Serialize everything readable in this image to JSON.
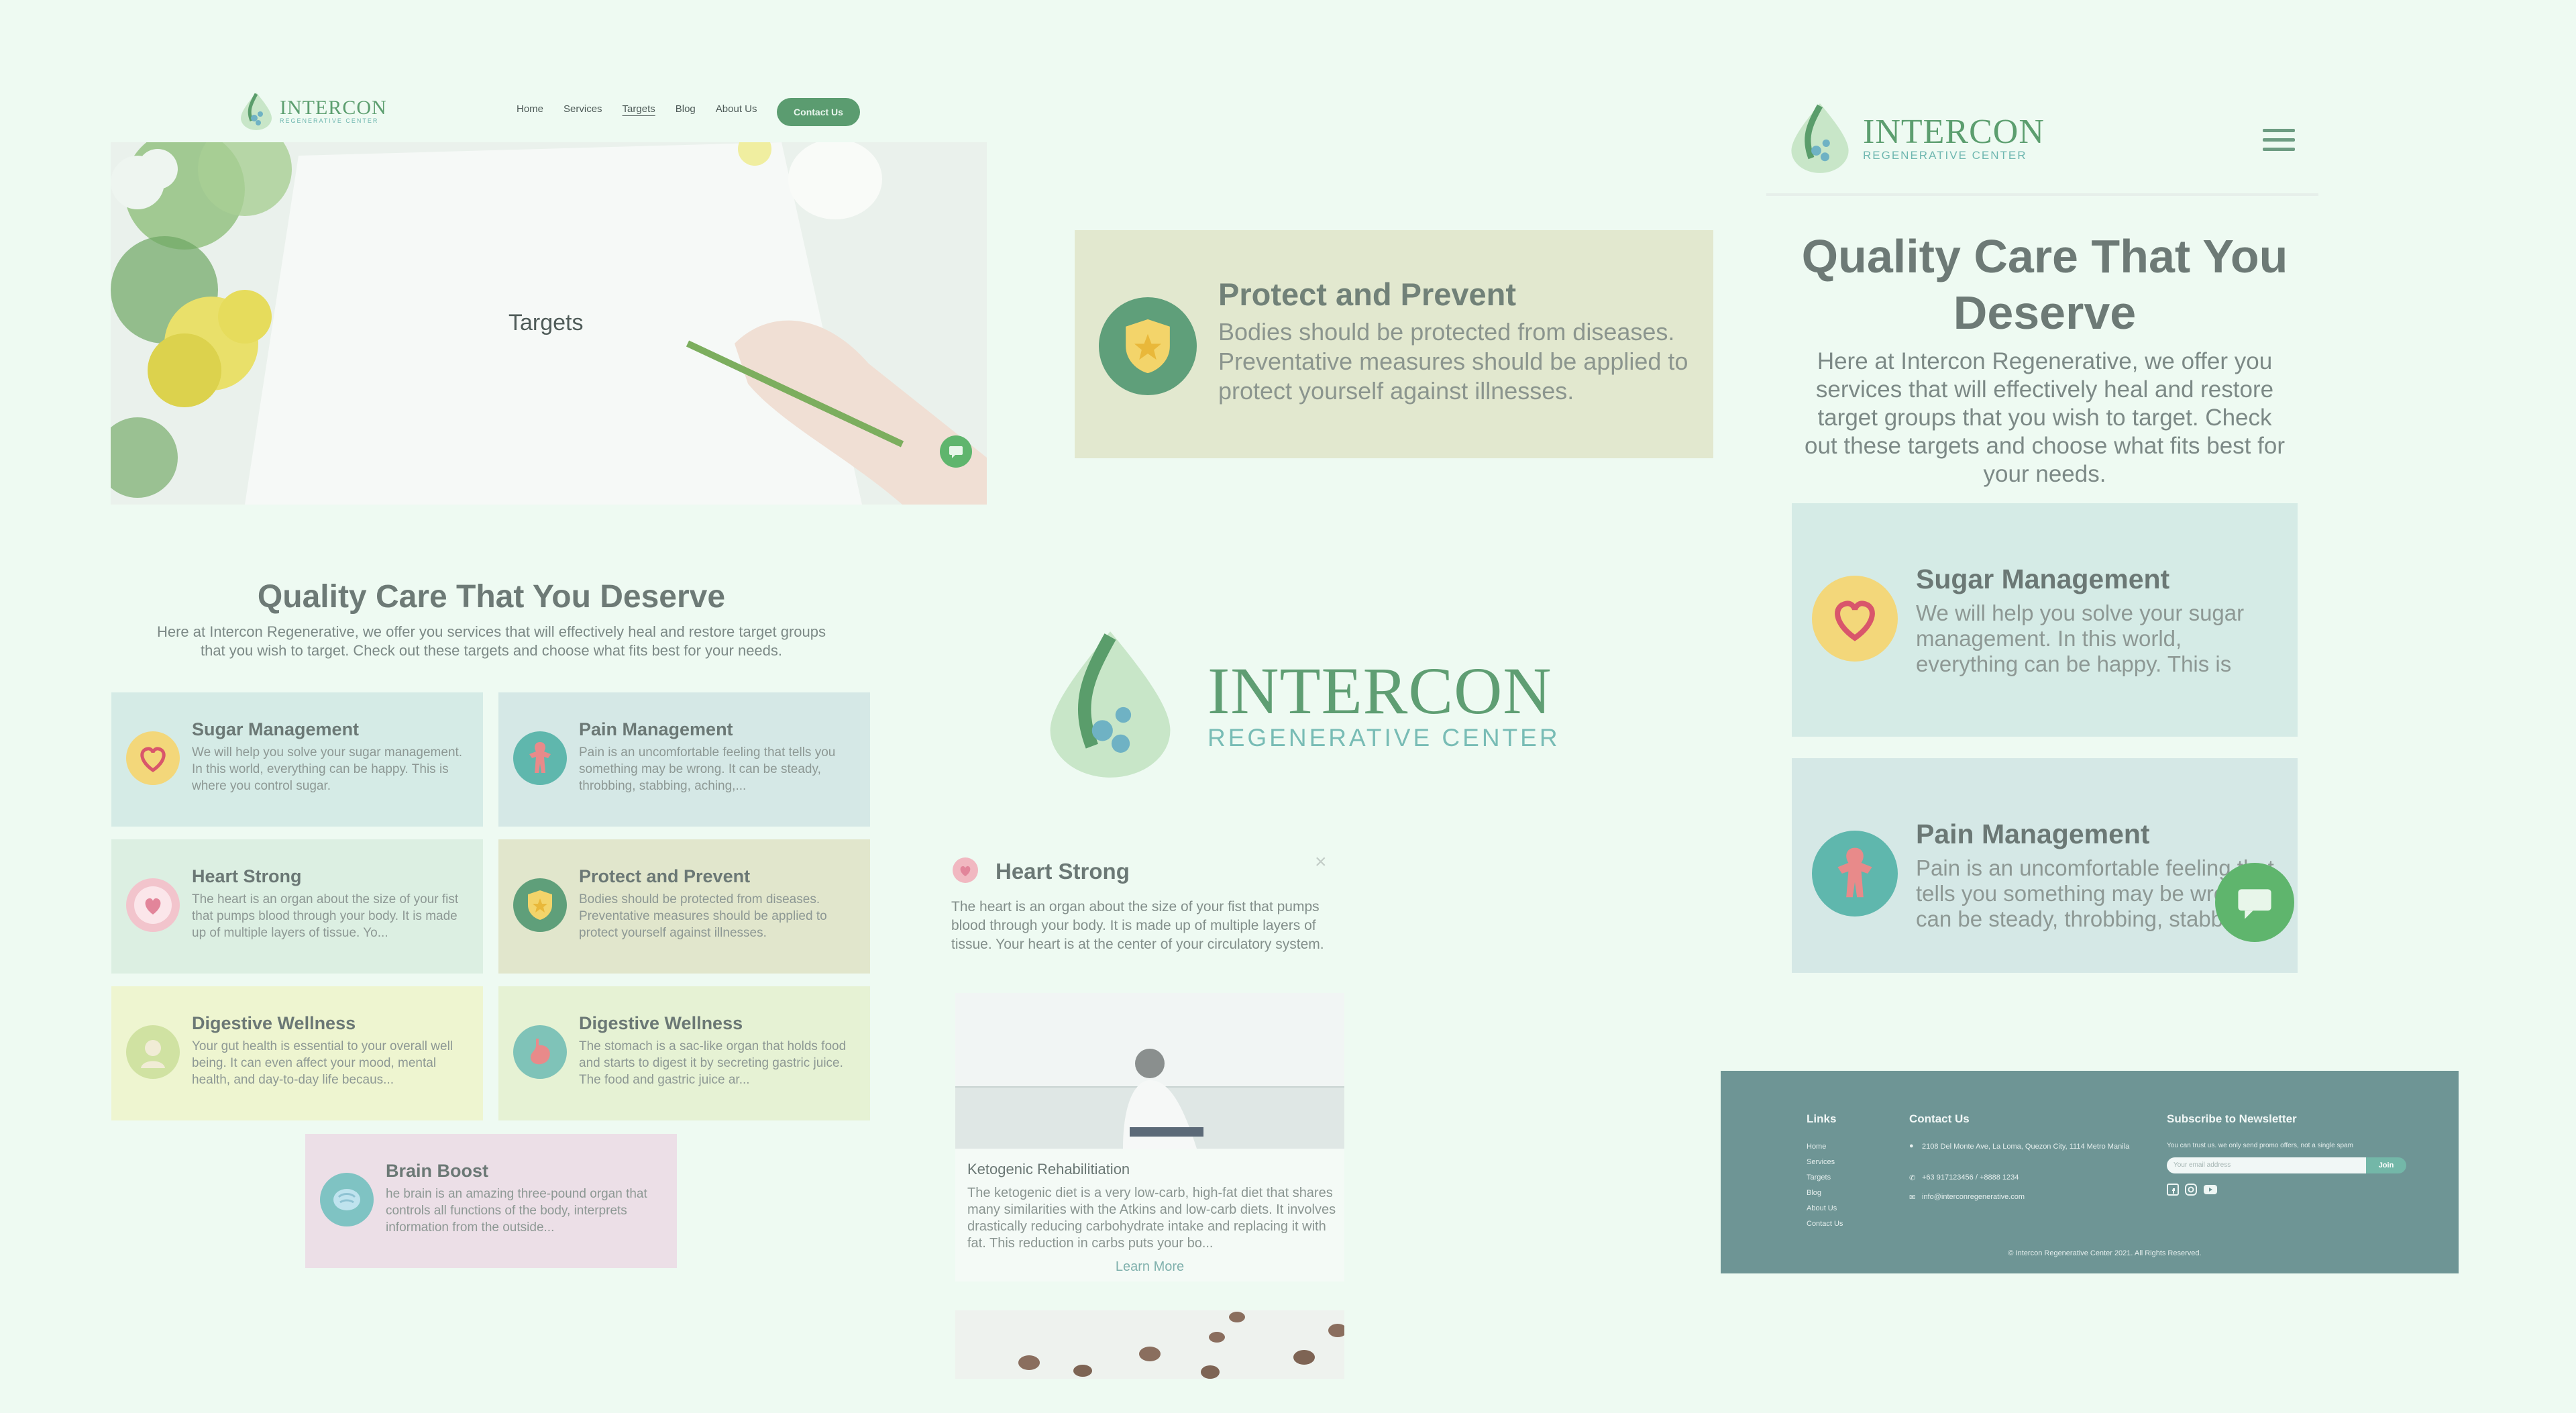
{
  "desktop": {
    "logo": {
      "name": "INTERCON",
      "tagline": "REGENERATIVE CENTER"
    },
    "nav": [
      "Home",
      "Services",
      "Targets",
      "Blog",
      "About Us"
    ],
    "contact_button": "Contact Us",
    "hero_title": "Targets",
    "heading": "Quality Care That You Deserve",
    "subheading": "Here at Intercon Regenerative, we offer you services that will effectively heal and restore target groups that you wish to target. Check out these targets and choose what fits best for your needs.",
    "cards": [
      {
        "title": "Sugar Management",
        "desc": "We will help you solve your sugar management. In this world, everything can be happy. This is where you control sugar.",
        "bg": "#d5ebe6",
        "icon_bg": "#f3d77a"
      },
      {
        "title": "Pain Management",
        "desc": "Pain is an uncomfortable feeling that tells you something may be wrong. It can be steady, throbbing, stabbing, aching,...",
        "bg": "#d5e8e6",
        "icon_bg": "#5fb7ad"
      },
      {
        "title": "Heart Strong",
        "desc": "The heart is an organ about the size of your fist that pumps blood through your body. It is made up of multiple layers of tissue. Yo...",
        "bg": "#dcefe2",
        "icon_bg": "#f2c4cc"
      },
      {
        "title": "Protect and Prevent",
        "desc": "Bodies should be protected from diseases. Preventative measures should be applied to protect yourself against illnesses.",
        "bg": "#e1e6cc",
        "icon_bg": "#5f9f7a"
      },
      {
        "title": "Digestive Wellness",
        "desc": "Your gut health is essential to your overall well being. It can even affect your mood, mental health, and day-to-day life becaus...",
        "bg": "#eef5d0",
        "icon_bg": "#d0e2a2"
      },
      {
        "title": "Digestive Wellness",
        "desc": "The stomach is a sac-like organ that holds food and starts to digest it by secreting gastric juice. The food and gastric juice ar...",
        "bg": "#e6f2d4",
        "icon_bg": "#7fc3b8"
      },
      {
        "title": "Brain Boost",
        "desc": "he brain is an amazing three-pound organ that controls all functions of the body, interprets information from the outside...",
        "bg": "#ecdfe7",
        "icon_bg": "#7fc3c3"
      }
    ]
  },
  "feature_card": {
    "title": "Protect and Prevent",
    "desc": "Bodies should be protected from diseases. Preventative measures should be applied to protect yourself against illnesses."
  },
  "center_logo": {
    "name": "INTERCON",
    "tagline": "REGENERATIVE CENTER"
  },
  "modal": {
    "title": "Heart Strong",
    "close": "×",
    "desc": "The heart is an organ about the size of your fist that pumps blood through your body. It is made up of multiple layers of tissue. Your heart is at the center of your circulatory system.",
    "article": {
      "title": "Ketogenic Rehabilitiation",
      "desc": "The ketogenic diet is a very low-carb, high-fat diet that shares many similarities with the Atkins and low-carb diets. It involves drastically reducing carbohydrate intake and replacing it with fat. This reduction in carbs puts your bo...",
      "link": "Learn More"
    }
  },
  "mobile": {
    "logo": {
      "name": "INTERCON",
      "tagline": "REGENERATIVE CENTER"
    },
    "heading": "Quality Care That You Deserve",
    "subheading": "Here at Intercon Regenerative, we offer you services that will effectively heal and restore target groups that you wish to target. Check out these targets and choose what fits best for your needs.",
    "cards": [
      {
        "title": "Sugar Management",
        "desc": "We will help you solve your sugar management. In this world, everything can be happy. This is where you..."
      },
      {
        "title": "Pain Management",
        "desc": "Pain is an uncomfortable feeling that tells you something may be wrong. It can be steady, throbbing, stabbing..."
      }
    ]
  },
  "footer": {
    "links_title": "Links",
    "links": [
      "Home",
      "Services",
      "Targets",
      "Blog",
      "About Us",
      "Contact Us"
    ],
    "contact_title": "Contact Us",
    "address": "2108 Del Monte Ave, La Loma, Quezon City, 1114 Metro Manila",
    "phone": "+63 917123456 / +8888 1234",
    "email": "info@interconregenerative.com",
    "newsletter_title": "Subscribe to Newsletter",
    "newsletter_note": "You can trust us. we only send promo offers, not a single spam",
    "email_placeholder": "Your email address",
    "join": "Join",
    "copyright": "© Intercon Regenerative Center 2021. All Rights Reserved."
  }
}
